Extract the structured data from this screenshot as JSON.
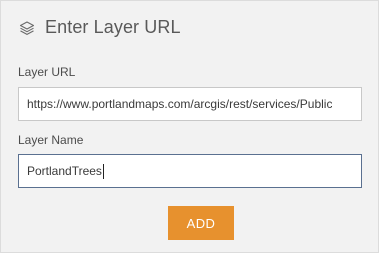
{
  "header": {
    "icon": "layers-icon",
    "title": "Enter Layer URL"
  },
  "layer_url": {
    "label": "Layer URL",
    "value": "https://www.portlandmaps.com/arcgis/rest/services/Public"
  },
  "layer_name": {
    "label": "Layer Name",
    "value": "PortlandTrees"
  },
  "add_button": {
    "label": "ADD",
    "color": "#e7912e"
  }
}
